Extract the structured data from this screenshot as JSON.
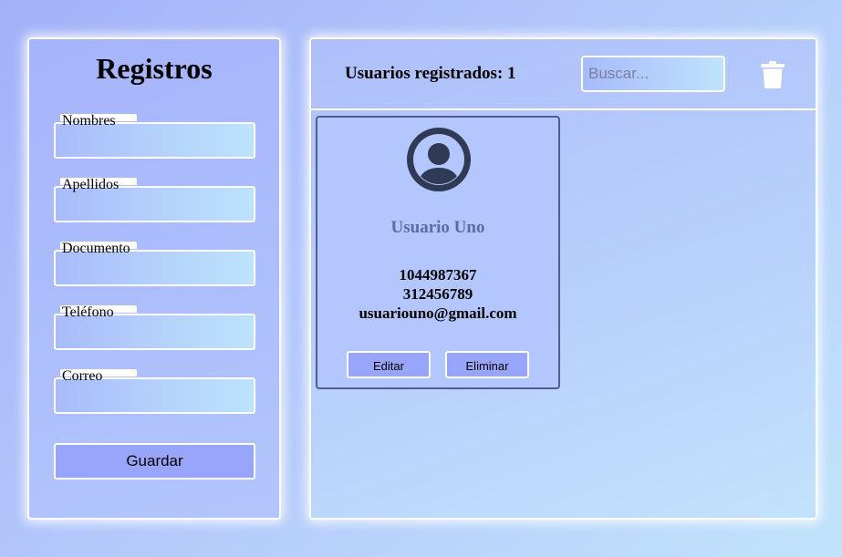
{
  "form": {
    "title": "Registros",
    "fields": [
      {
        "label": "Nombres",
        "value": ""
      },
      {
        "label": "Apellidos",
        "value": ""
      },
      {
        "label": "Documento",
        "value": ""
      },
      {
        "label": "Teléfono",
        "value": ""
      },
      {
        "label": "Correo",
        "value": ""
      }
    ],
    "save_label": "Guardar"
  },
  "list": {
    "count_label": "Usuarios registrados: 1",
    "search": {
      "placeholder": "Buscar...",
      "value": ""
    },
    "clear_icon": "trash-icon",
    "users": [
      {
        "name": "Usuario Uno",
        "document": "1044987367",
        "phone": "312456789",
        "email": "usuariouno@gmail.com",
        "avatar_icon": "user-circle-icon",
        "edit_label": "Editar",
        "delete_label": "Eliminar"
      }
    ]
  },
  "colors": {
    "button_fill": "#99a5fa",
    "card_border": "#4f5c8d",
    "name_color": "#5c6aa6",
    "avatar_color": "#303a55"
  }
}
